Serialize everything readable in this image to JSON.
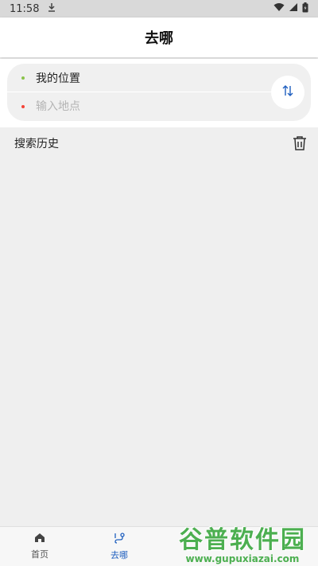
{
  "status_bar": {
    "time": "11:58"
  },
  "header": {
    "title": "去哪"
  },
  "route": {
    "from_text": "我的位置",
    "to_placeholder": "输入地点",
    "from_dot_color": "#8bc34a",
    "to_dot_color": "#f44336"
  },
  "history": {
    "label": "搜索历史"
  },
  "nav": {
    "items": [
      {
        "label": "首页",
        "icon": "home-icon"
      },
      {
        "label": "去哪",
        "icon": "route-icon"
      }
    ],
    "active_color": "#1f5fbf"
  },
  "watermark": {
    "title": "谷普软件园",
    "url": "www.gupuxiazai.com"
  }
}
